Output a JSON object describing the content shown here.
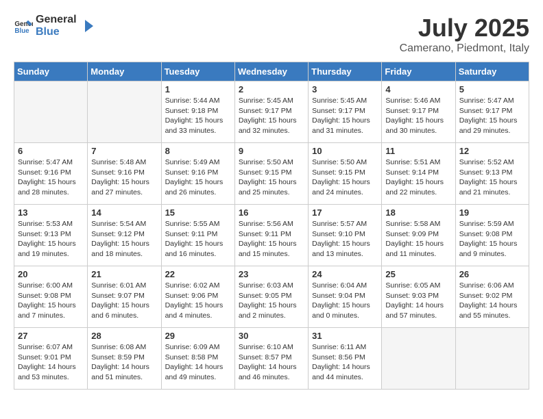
{
  "header": {
    "logo_line1": "General",
    "logo_line2": "Blue",
    "month": "July 2025",
    "location": "Camerano, Piedmont, Italy"
  },
  "weekdays": [
    "Sunday",
    "Monday",
    "Tuesday",
    "Wednesday",
    "Thursday",
    "Friday",
    "Saturday"
  ],
  "weeks": [
    [
      {
        "day": "",
        "info": ""
      },
      {
        "day": "",
        "info": ""
      },
      {
        "day": "1",
        "info": "Sunrise: 5:44 AM\nSunset: 9:18 PM\nDaylight: 15 hours\nand 33 minutes."
      },
      {
        "day": "2",
        "info": "Sunrise: 5:45 AM\nSunset: 9:17 PM\nDaylight: 15 hours\nand 32 minutes."
      },
      {
        "day": "3",
        "info": "Sunrise: 5:45 AM\nSunset: 9:17 PM\nDaylight: 15 hours\nand 31 minutes."
      },
      {
        "day": "4",
        "info": "Sunrise: 5:46 AM\nSunset: 9:17 PM\nDaylight: 15 hours\nand 30 minutes."
      },
      {
        "day": "5",
        "info": "Sunrise: 5:47 AM\nSunset: 9:17 PM\nDaylight: 15 hours\nand 29 minutes."
      }
    ],
    [
      {
        "day": "6",
        "info": "Sunrise: 5:47 AM\nSunset: 9:16 PM\nDaylight: 15 hours\nand 28 minutes."
      },
      {
        "day": "7",
        "info": "Sunrise: 5:48 AM\nSunset: 9:16 PM\nDaylight: 15 hours\nand 27 minutes."
      },
      {
        "day": "8",
        "info": "Sunrise: 5:49 AM\nSunset: 9:16 PM\nDaylight: 15 hours\nand 26 minutes."
      },
      {
        "day": "9",
        "info": "Sunrise: 5:50 AM\nSunset: 9:15 PM\nDaylight: 15 hours\nand 25 minutes."
      },
      {
        "day": "10",
        "info": "Sunrise: 5:50 AM\nSunset: 9:15 PM\nDaylight: 15 hours\nand 24 minutes."
      },
      {
        "day": "11",
        "info": "Sunrise: 5:51 AM\nSunset: 9:14 PM\nDaylight: 15 hours\nand 22 minutes."
      },
      {
        "day": "12",
        "info": "Sunrise: 5:52 AM\nSunset: 9:13 PM\nDaylight: 15 hours\nand 21 minutes."
      }
    ],
    [
      {
        "day": "13",
        "info": "Sunrise: 5:53 AM\nSunset: 9:13 PM\nDaylight: 15 hours\nand 19 minutes."
      },
      {
        "day": "14",
        "info": "Sunrise: 5:54 AM\nSunset: 9:12 PM\nDaylight: 15 hours\nand 18 minutes."
      },
      {
        "day": "15",
        "info": "Sunrise: 5:55 AM\nSunset: 9:11 PM\nDaylight: 15 hours\nand 16 minutes."
      },
      {
        "day": "16",
        "info": "Sunrise: 5:56 AM\nSunset: 9:11 PM\nDaylight: 15 hours\nand 15 minutes."
      },
      {
        "day": "17",
        "info": "Sunrise: 5:57 AM\nSunset: 9:10 PM\nDaylight: 15 hours\nand 13 minutes."
      },
      {
        "day": "18",
        "info": "Sunrise: 5:58 AM\nSunset: 9:09 PM\nDaylight: 15 hours\nand 11 minutes."
      },
      {
        "day": "19",
        "info": "Sunrise: 5:59 AM\nSunset: 9:08 PM\nDaylight: 15 hours\nand 9 minutes."
      }
    ],
    [
      {
        "day": "20",
        "info": "Sunrise: 6:00 AM\nSunset: 9:08 PM\nDaylight: 15 hours\nand 7 minutes."
      },
      {
        "day": "21",
        "info": "Sunrise: 6:01 AM\nSunset: 9:07 PM\nDaylight: 15 hours\nand 6 minutes."
      },
      {
        "day": "22",
        "info": "Sunrise: 6:02 AM\nSunset: 9:06 PM\nDaylight: 15 hours\nand 4 minutes."
      },
      {
        "day": "23",
        "info": "Sunrise: 6:03 AM\nSunset: 9:05 PM\nDaylight: 15 hours\nand 2 minutes."
      },
      {
        "day": "24",
        "info": "Sunrise: 6:04 AM\nSunset: 9:04 PM\nDaylight: 15 hours\nand 0 minutes."
      },
      {
        "day": "25",
        "info": "Sunrise: 6:05 AM\nSunset: 9:03 PM\nDaylight: 14 hours\nand 57 minutes."
      },
      {
        "day": "26",
        "info": "Sunrise: 6:06 AM\nSunset: 9:02 PM\nDaylight: 14 hours\nand 55 minutes."
      }
    ],
    [
      {
        "day": "27",
        "info": "Sunrise: 6:07 AM\nSunset: 9:01 PM\nDaylight: 14 hours\nand 53 minutes."
      },
      {
        "day": "28",
        "info": "Sunrise: 6:08 AM\nSunset: 8:59 PM\nDaylight: 14 hours\nand 51 minutes."
      },
      {
        "day": "29",
        "info": "Sunrise: 6:09 AM\nSunset: 8:58 PM\nDaylight: 14 hours\nand 49 minutes."
      },
      {
        "day": "30",
        "info": "Sunrise: 6:10 AM\nSunset: 8:57 PM\nDaylight: 14 hours\nand 46 minutes."
      },
      {
        "day": "31",
        "info": "Sunrise: 6:11 AM\nSunset: 8:56 PM\nDaylight: 14 hours\nand 44 minutes."
      },
      {
        "day": "",
        "info": ""
      },
      {
        "day": "",
        "info": ""
      }
    ]
  ]
}
